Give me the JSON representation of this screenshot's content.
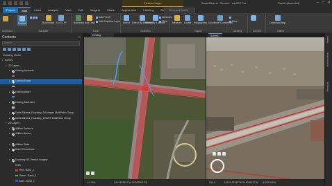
{
  "titlebar": {
    "context_tab": "Feature Layer",
    "app_title": "SanfeMineral - Scene1 - ArcGIS Pro",
    "user": "Daniel (dsstrobel)",
    "minimize": "–",
    "maximize": "□",
    "close": "✕"
  },
  "ribbon_tabs": [
    "Project",
    "Map",
    "Insert",
    "Analysis",
    "View",
    "Edit",
    "Imagery",
    "Share",
    "Appearance",
    "Labeling",
    "Data"
  ],
  "command_search": "Command Search (Alt+Q)",
  "ribbon": {
    "clipboard_label": "Clipboard",
    "explore_label": "Explore",
    "bookmarks_label": "Bookmarks",
    "goto_label": "Go To XY",
    "navigate_label": "Navigate",
    "basemap_label": "Basemap",
    "add_data_label": "Add Data",
    "add_preset_label": "Add Preset",
    "add_graphics_label": "Add Graphics Layer",
    "layer_label": "Layer",
    "select_label": "Select",
    "select_by_attr_label": "Select By Attributes",
    "select_by_loc_label": "Select By Location",
    "selection_label": "Selection",
    "attributes_label": "Attributes",
    "clear_label": "Clear",
    "measure_label": "Measure",
    "locate_label": "Locate",
    "infographics_label": "Infographics",
    "coordinate_label": "Coordinate Conversion",
    "inquiry_label": "Inquiry",
    "labeling_group_label": "Labeling",
    "convert_label": "Convert",
    "download_label": "Download Map",
    "offline_label": "Offline",
    "more_label": "More"
  },
  "contents": {
    "title": "Contents",
    "search_placeholder": "Search",
    "drawing_order": "Drawing Order",
    "tree": [
      {
        "level": 0,
        "label": "Scene1",
        "checked": false,
        "expand": "▾",
        "swatch": ""
      },
      {
        "level": 1,
        "label": "3D Layers",
        "checked": false,
        "expand": "▾",
        "swatch": ""
      },
      {
        "level": 2,
        "label": "Existing Hydrants",
        "checked": true,
        "expand": "▸",
        "swatch": ""
      },
      {
        "level": 2,
        "label": "",
        "checked": false,
        "expand": "",
        "swatch": "#e05050"
      },
      {
        "level": 2,
        "label": "Existing Sewer",
        "checked": true,
        "expand": "▸",
        "swatch": "",
        "selected": true
      },
      {
        "level": 2,
        "label": "",
        "checked": false,
        "expand": "",
        "swatch": "#b0b0b0"
      },
      {
        "level": 2,
        "label": "Existing Water",
        "checked": true,
        "expand": "▸",
        "swatch": ""
      },
      {
        "level": 2,
        "label": "",
        "checked": false,
        "expand": "",
        "swatch": "#4d8fe0"
      },
      {
        "level": 2,
        "label": "Existing Manholes",
        "checked": true,
        "expand": "▸",
        "swatch": ""
      },
      {
        "level": 2,
        "label": "",
        "checked": false,
        "expand": "",
        "swatch": "#c8c8c8"
      },
      {
        "level": 2,
        "label": "Sanfe-Mineral_Roadway_3d-shapes MultiPatch Group",
        "checked": true,
        "expand": "▸",
        "swatch": ""
      },
      {
        "level": 2,
        "label": "Sanfe-Mineral_Roadway_wSURF MultiPatch Group",
        "checked": true,
        "expand": "▸",
        "swatch": ""
      },
      {
        "level": 1,
        "label": "2D Layers",
        "checked": false,
        "expand": "▾",
        "swatch": ""
      },
      {
        "level": 2,
        "label": "Utilities Surfaces",
        "checked": true,
        "expand": "▸",
        "swatch": ""
      },
      {
        "level": 2,
        "label": "Utilities Basins",
        "checked": true,
        "expand": "▸",
        "swatch": ""
      },
      {
        "level": 2,
        "label": "",
        "checked": false,
        "expand": "",
        "swatch": ""
      },
      {
        "level": 2,
        "label": "Utilities Slabs",
        "checked": true,
        "expand": "▸",
        "swatch": ""
      },
      {
        "level": 2,
        "label": "Street Centerlines",
        "checked": true,
        "expand": "▸",
        "swatch": ""
      },
      {
        "level": 2,
        "label": "",
        "checked": false,
        "expand": "",
        "swatch": ""
      },
      {
        "level": 2,
        "label": "Roadmap US Vertical Imagery",
        "checked": true,
        "expand": "▾",
        "swatch": ""
      },
      {
        "level": 3,
        "label": "RGB",
        "checked": false,
        "expand": "",
        "swatch": ""
      },
      {
        "level": 3,
        "label": "Red : Band_1",
        "checked": false,
        "expand": "",
        "swatch": "#e03030"
      },
      {
        "level": 3,
        "label": "Green : Band_2",
        "checked": false,
        "expand": "",
        "swatch": "#30c030"
      },
      {
        "level": 3,
        "label": "Blue : Band_3",
        "checked": false,
        "expand": "",
        "swatch": "#3050e0"
      }
    ]
  },
  "views": {
    "map_tab": "Existing Conditions",
    "scene_tab": "Scene1"
  },
  "status": {
    "map_scale": "1:4,165",
    "map_coords": "105.0192561°W 39.6035012°N",
    "scene_scale": "290 ft",
    "scene_coords": "105.0193240°W 39.6038172°N",
    "scene_elev": "5,293.948 ft"
  },
  "right_tabs": [
    "Catalog",
    "Geoprocessing",
    "Symbology"
  ]
}
